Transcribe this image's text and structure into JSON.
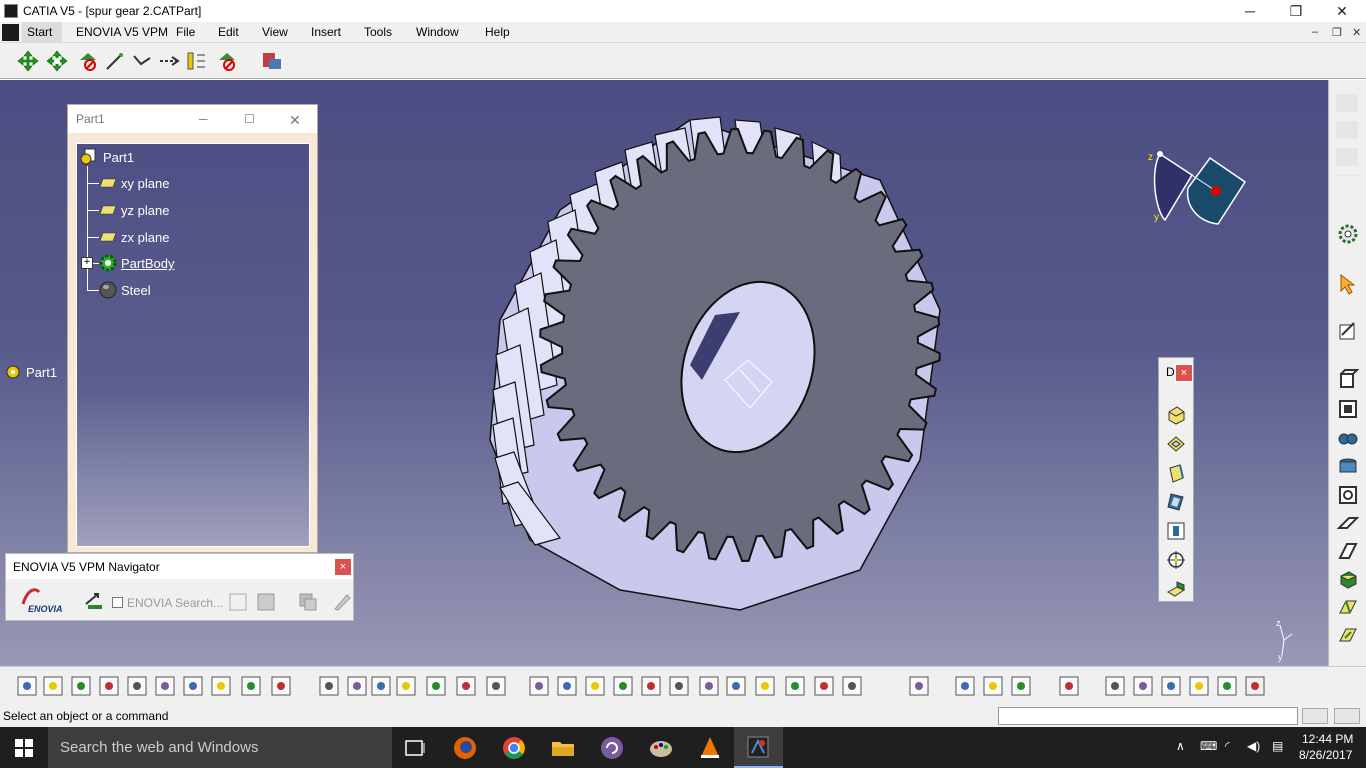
{
  "window": {
    "title": "CATIA V5 - [spur gear 2.CATPart]",
    "minimize": "─",
    "maximize": "❐",
    "close": "✕"
  },
  "menu": {
    "start": "Start",
    "items": [
      "ENOVIA V5 VPM",
      "File",
      "Edit",
      "View",
      "Insert",
      "Tools",
      "Window",
      "Help"
    ]
  },
  "tree_window": {
    "title": "Part1",
    "nodes": [
      "Part1",
      "xy plane",
      "yz plane",
      "zx plane",
      "PartBody",
      "Steel"
    ]
  },
  "viewport": {
    "part_label": "Part1",
    "axis_labels": {
      "x": "x",
      "y": "y",
      "z": "z"
    }
  },
  "navigator": {
    "title": "ENOVIA V5 VPM Navigator",
    "logo_text": "ENOVIA",
    "search_label": "ENOVIA Search..."
  },
  "dpanel": {
    "title": "D"
  },
  "status": {
    "message": "Select an object or a command"
  },
  "taskbar": {
    "search_placeholder": "Search the web and Windows",
    "time": "12:44 PM",
    "date": "8/26/2017"
  },
  "icons": {
    "top_toolbar": [
      "pan-icon",
      "rotate-icon",
      "snap-icon",
      "line-icon",
      "connect-icon",
      "distance-icon",
      "vertical-icon",
      "measure-icon",
      "catalog-icon"
    ],
    "bottom_toolbar": [
      "new-icon",
      "open-icon",
      "save-icon",
      "print-icon",
      "cut-icon",
      "copy-icon",
      "paste-icon",
      "undo-icon",
      "redo-icon",
      "whats-this-icon",
      "formula-icon",
      "comment-icon",
      "knowledge-icon",
      "table-icon",
      "tree-icon",
      "lock-icon",
      "params-icon",
      "fly-icon",
      "fit-all-icon",
      "pan-icon",
      "rotate-icon",
      "zoom-in-icon",
      "zoom-out-icon",
      "normal-view-icon",
      "multi-view-icon",
      "iso-view-icon",
      "shading-icon",
      "hide-show-icon",
      "swap-icon",
      "measure-icon",
      "inertia-icon",
      "mass-icon",
      "capture-icon",
      "update-icon",
      "hand-icon",
      "axis-icon",
      "decimal-icon",
      "snap-icon",
      "geometry-icon",
      "catia-logo-icon"
    ]
  },
  "colors": {
    "viewport_top": "#4c4d82",
    "viewport_bottom": "#9899b6",
    "gear_face": "#6a6b7c",
    "gear_teeth": "#c8c9ec",
    "axis_red": "#e00000"
  }
}
